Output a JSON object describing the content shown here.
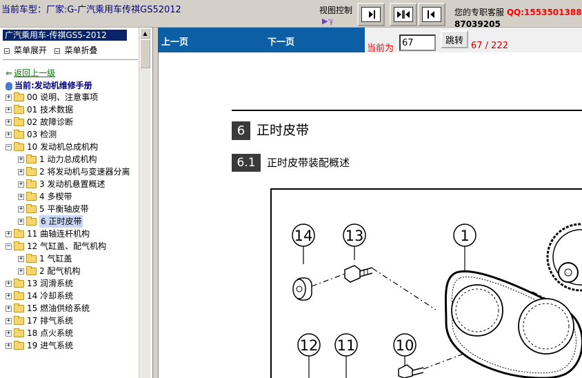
{
  "header": {
    "car_title": "当前车型：厂家:G-广汽乘用车传祺GS52012",
    "view_control_label": "视图控制",
    "view_control_icon": "sound-icon",
    "view_buttons": [
      "next-page-icon",
      "fit-split-icon",
      "prev-page-icon"
    ],
    "contact_label": "您的专职客服",
    "contact_qq": "QQ:1553501388",
    "contact_number": "87039205"
  },
  "sidebar": {
    "title": "广汽乘用车-传祺GS5-2012",
    "expand_label": "菜单展开",
    "collapse_label": "菜单折叠",
    "back_label": "返回上一级",
    "current_label": "当前:发动机维修手册",
    "tree": [
      {
        "label": "00 说明、注意事项",
        "level": 0,
        "expanded": false
      },
      {
        "label": "01 技术数据",
        "level": 0,
        "expanded": false
      },
      {
        "label": "02 故障诊断",
        "level": 0,
        "expanded": false
      },
      {
        "label": "03 检测",
        "level": 0,
        "expanded": false
      },
      {
        "label": "10 发动机总成机构",
        "level": 0,
        "expanded": true
      },
      {
        "label": "1 动力总成机构",
        "level": 1,
        "expanded": false
      },
      {
        "label": "2 将发动机与变速器分离",
        "level": 1,
        "expanded": false
      },
      {
        "label": "3 发动机悬置概述",
        "level": 1,
        "expanded": false
      },
      {
        "label": "4 多楔带",
        "level": 1,
        "expanded": false
      },
      {
        "label": "5 平衡轴皮带",
        "level": 1,
        "expanded": false
      },
      {
        "label": "6 正时皮带",
        "level": 1,
        "expanded": false,
        "selected": true
      },
      {
        "label": "11 曲轴连杆机构",
        "level": 0,
        "expanded": false
      },
      {
        "label": "12 气缸盖、配气机构",
        "level": 0,
        "expanded": true
      },
      {
        "label": "1 气缸盖",
        "level": 1,
        "expanded": false
      },
      {
        "label": "2 配气机构",
        "level": 1,
        "expanded": false
      },
      {
        "label": "13 润滑系统",
        "level": 0,
        "expanded": false
      },
      {
        "label": "14 冷却系统",
        "level": 0,
        "expanded": false
      },
      {
        "label": "15 燃油供给系统",
        "level": 0,
        "expanded": false
      },
      {
        "label": "17 排气系统",
        "level": 0,
        "expanded": false
      },
      {
        "label": "18 点火系统",
        "level": 0,
        "expanded": false
      },
      {
        "label": "19 进气系统",
        "level": 0,
        "expanded": false
      }
    ]
  },
  "nav": {
    "prev_label": "上一页",
    "next_label": "下一页",
    "current_label": "当前为",
    "page_value": "67",
    "jump_label": "跳转",
    "page_count": "67 / 222"
  },
  "document": {
    "section_number": "6",
    "section_title": "正时皮带",
    "subsection_number": "6.1",
    "subsection_title": "正时皮带装配概述",
    "callouts": [
      "14",
      "13",
      "1",
      "12",
      "11",
      "10"
    ]
  },
  "colors": {
    "nav_bar": "#0d5fa5",
    "sidebar_header": "#0a246a",
    "section_box": "#3a3a3a",
    "qq_red": "#ff0000"
  }
}
